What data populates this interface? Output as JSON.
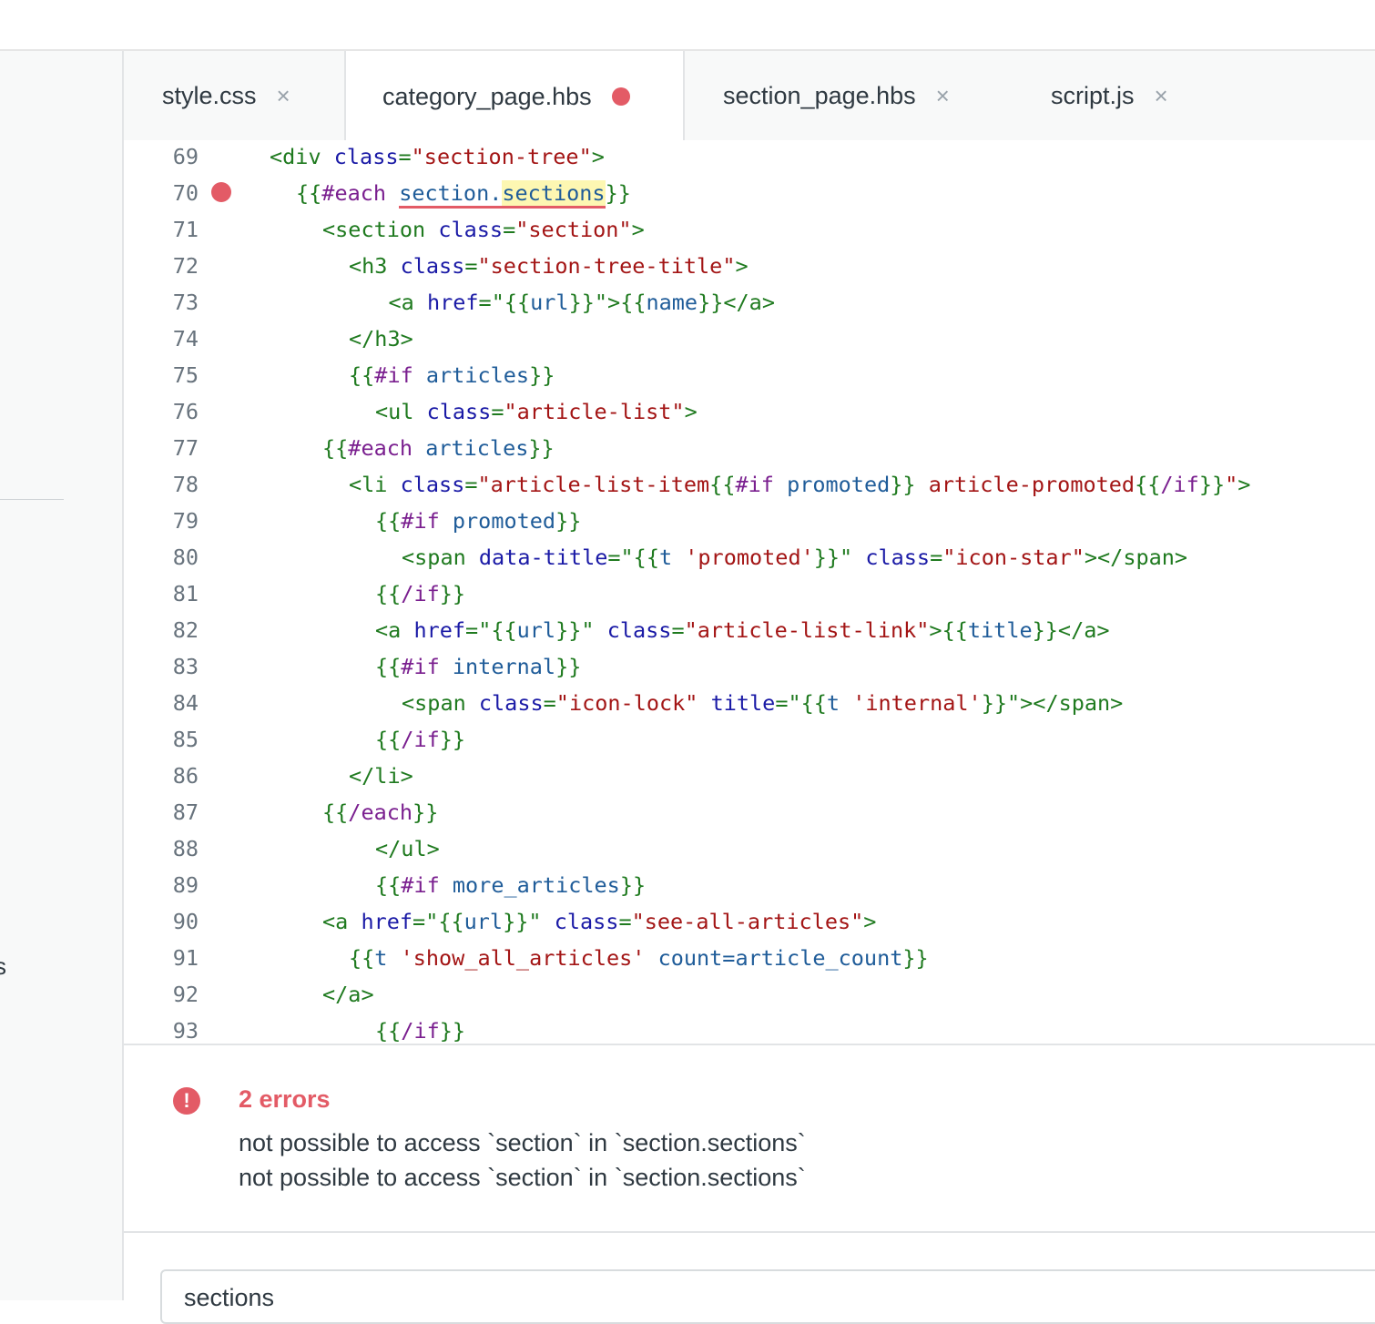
{
  "tabs": [
    {
      "label": "style.css",
      "state": "close",
      "active": false
    },
    {
      "label": "category_page.hbs",
      "state": "error-dot",
      "active": true
    },
    {
      "label": "section_page.hbs",
      "state": "close",
      "active": false
    },
    {
      "label": "script.js",
      "state": "close",
      "active": false
    }
  ],
  "close_glyph": "×",
  "sidebar": {
    "partial_text": "s"
  },
  "code_lines": [
    {
      "n": "69",
      "t": [
        [
          "c-tag",
          "<div "
        ],
        [
          "c-attr",
          "class"
        ],
        [
          "c-tag",
          "="
        ],
        [
          "c-str",
          "\"section-tree\""
        ],
        [
          "c-tag",
          ">"
        ]
      ],
      "indent": 0
    },
    {
      "n": "70",
      "t": [
        [
          "c-hbs",
          "{{"
        ],
        [
          "c-kw",
          "#each "
        ],
        [
          "c-var squiggle",
          "section."
        ],
        [
          "c-var squiggle hl",
          "sections"
        ],
        [
          "c-hbs",
          "}}"
        ]
      ],
      "indent": 1,
      "breakpoint": true
    },
    {
      "n": "71",
      "t": [
        [
          "c-tag",
          "<section "
        ],
        [
          "c-attr",
          "class"
        ],
        [
          "c-tag",
          "="
        ],
        [
          "c-str",
          "\"section\""
        ],
        [
          "c-tag",
          ">"
        ]
      ],
      "indent": 2
    },
    {
      "n": "72",
      "t": [
        [
          "c-tag",
          "<h3 "
        ],
        [
          "c-attr",
          "class"
        ],
        [
          "c-tag",
          "="
        ],
        [
          "c-str",
          "\"section-tree-title\""
        ],
        [
          "c-tag",
          ">"
        ]
      ],
      "indent": 3
    },
    {
      "n": "73",
      "t": [
        [
          "c-tag",
          "<a "
        ],
        [
          "c-attr",
          "href"
        ],
        [
          "c-tag",
          "=\""
        ],
        [
          "c-hbs",
          "{{"
        ],
        [
          "c-var",
          "url"
        ],
        [
          "c-hbs",
          "}}"
        ],
        [
          "c-tag",
          "\">"
        ],
        [
          "c-hbs",
          "{{"
        ],
        [
          "c-var",
          "name"
        ],
        [
          "c-hbs",
          "}}"
        ],
        [
          "c-tag",
          "</a>"
        ]
      ],
      "indent": 4.5
    },
    {
      "n": "74",
      "t": [
        [
          "c-tag",
          "</h3>"
        ]
      ],
      "indent": 3
    },
    {
      "n": "75",
      "t": [
        [
          "c-hbs",
          "{{"
        ],
        [
          "c-kw",
          "#if "
        ],
        [
          "c-var",
          "articles"
        ],
        [
          "c-hbs",
          "}}"
        ]
      ],
      "indent": 3
    },
    {
      "n": "76",
      "t": [
        [
          "c-tag",
          "<ul "
        ],
        [
          "c-attr",
          "class"
        ],
        [
          "c-tag",
          "="
        ],
        [
          "c-str",
          "\"article-list\""
        ],
        [
          "c-tag",
          ">"
        ]
      ],
      "indent": 4
    },
    {
      "n": "77",
      "t": [
        [
          "c-hbs",
          "{{"
        ],
        [
          "c-kw",
          "#each "
        ],
        [
          "c-var",
          "articles"
        ],
        [
          "c-hbs",
          "}}"
        ]
      ],
      "indent": 2
    },
    {
      "n": "78",
      "t": [
        [
          "c-tag",
          "<li "
        ],
        [
          "c-attr",
          "class"
        ],
        [
          "c-tag",
          "="
        ],
        [
          "c-str",
          "\"article-list-item"
        ],
        [
          "c-hbs",
          "{{"
        ],
        [
          "c-kw",
          "#if "
        ],
        [
          "c-var",
          "promoted"
        ],
        [
          "c-hbs",
          "}}"
        ],
        [
          "c-str",
          " article-promoted"
        ],
        [
          "c-hbs",
          "{{"
        ],
        [
          "c-kw",
          "/if"
        ],
        [
          "c-hbs",
          "}}"
        ],
        [
          "c-str",
          "\""
        ],
        [
          "c-tag",
          ">"
        ]
      ],
      "indent": 3
    },
    {
      "n": "79",
      "t": [
        [
          "c-hbs",
          "{{"
        ],
        [
          "c-kw",
          "#if "
        ],
        [
          "c-var",
          "promoted"
        ],
        [
          "c-hbs",
          "}}"
        ]
      ],
      "indent": 4
    },
    {
      "n": "80",
      "t": [
        [
          "c-tag",
          "<span "
        ],
        [
          "c-attr",
          "data-title"
        ],
        [
          "c-tag",
          "=\""
        ],
        [
          "c-hbs",
          "{{"
        ],
        [
          "c-var",
          "t "
        ],
        [
          "c-str",
          "'promoted'"
        ],
        [
          "c-hbs",
          "}}"
        ],
        [
          "c-tag",
          "\" "
        ],
        [
          "c-attr",
          "class"
        ],
        [
          "c-tag",
          "="
        ],
        [
          "c-str",
          "\"icon-star\""
        ],
        [
          "c-tag",
          "></span>"
        ]
      ],
      "indent": 5
    },
    {
      "n": "81",
      "t": [
        [
          "c-hbs",
          "{{"
        ],
        [
          "c-kw",
          "/if"
        ],
        [
          "c-hbs",
          "}}"
        ]
      ],
      "indent": 4
    },
    {
      "n": "82",
      "t": [
        [
          "c-tag",
          "<a "
        ],
        [
          "c-attr",
          "href"
        ],
        [
          "c-tag",
          "=\""
        ],
        [
          "c-hbs",
          "{{"
        ],
        [
          "c-var",
          "url"
        ],
        [
          "c-hbs",
          "}}"
        ],
        [
          "c-tag",
          "\" "
        ],
        [
          "c-attr",
          "class"
        ],
        [
          "c-tag",
          "="
        ],
        [
          "c-str",
          "\"article-list-link\""
        ],
        [
          "c-tag",
          ">"
        ],
        [
          "c-hbs",
          "{{"
        ],
        [
          "c-var",
          "title"
        ],
        [
          "c-hbs",
          "}}"
        ],
        [
          "c-tag",
          "</a>"
        ]
      ],
      "indent": 4
    },
    {
      "n": "83",
      "t": [
        [
          "c-hbs",
          "{{"
        ],
        [
          "c-kw",
          "#if "
        ],
        [
          "c-var",
          "internal"
        ],
        [
          "c-hbs",
          "}}"
        ]
      ],
      "indent": 4
    },
    {
      "n": "84",
      "t": [
        [
          "c-tag",
          "<span "
        ],
        [
          "c-attr",
          "class"
        ],
        [
          "c-tag",
          "="
        ],
        [
          "c-str",
          "\"icon-lock\" "
        ],
        [
          "c-attr",
          "title"
        ],
        [
          "c-tag",
          "=\""
        ],
        [
          "c-hbs",
          "{{"
        ],
        [
          "c-var",
          "t "
        ],
        [
          "c-str",
          "'internal'"
        ],
        [
          "c-hbs",
          "}}"
        ],
        [
          "c-tag",
          "\"></span>"
        ]
      ],
      "indent": 5
    },
    {
      "n": "85",
      "t": [
        [
          "c-hbs",
          "{{"
        ],
        [
          "c-kw",
          "/if"
        ],
        [
          "c-hbs",
          "}}"
        ]
      ],
      "indent": 4
    },
    {
      "n": "86",
      "t": [
        [
          "c-tag",
          "</li>"
        ]
      ],
      "indent": 3
    },
    {
      "n": "87",
      "t": [
        [
          "c-hbs",
          "{{"
        ],
        [
          "c-kw",
          "/each"
        ],
        [
          "c-hbs",
          "}}"
        ]
      ],
      "indent": 2
    },
    {
      "n": "88",
      "t": [
        [
          "c-tag",
          "</ul>"
        ]
      ],
      "indent": 4
    },
    {
      "n": "89",
      "t": [
        [
          "c-hbs",
          "{{"
        ],
        [
          "c-kw",
          "#if "
        ],
        [
          "c-var",
          "more_articles"
        ],
        [
          "c-hbs",
          "}}"
        ]
      ],
      "indent": 4
    },
    {
      "n": "90",
      "t": [
        [
          "c-tag",
          "<a "
        ],
        [
          "c-attr",
          "href"
        ],
        [
          "c-tag",
          "=\""
        ],
        [
          "c-hbs",
          "{{"
        ],
        [
          "c-var",
          "url"
        ],
        [
          "c-hbs",
          "}}"
        ],
        [
          "c-tag",
          "\" "
        ],
        [
          "c-attr",
          "class"
        ],
        [
          "c-tag",
          "="
        ],
        [
          "c-str",
          "\"see-all-articles\""
        ],
        [
          "c-tag",
          ">"
        ]
      ],
      "indent": 2
    },
    {
      "n": "91",
      "t": [
        [
          "c-hbs",
          "{{"
        ],
        [
          "c-var",
          "t "
        ],
        [
          "c-str",
          "'show_all_articles' "
        ],
        [
          "c-var",
          "count=article_count"
        ],
        [
          "c-hbs",
          "}}"
        ]
      ],
      "indent": 3
    },
    {
      "n": "92",
      "t": [
        [
          "c-tag",
          "</a>"
        ]
      ],
      "indent": 2
    },
    {
      "n": "93",
      "t": [
        [
          "c-hbs",
          "{{"
        ],
        [
          "c-kw",
          "/if"
        ],
        [
          "c-hbs",
          "}}"
        ]
      ],
      "indent": 4
    }
  ],
  "errors_panel": {
    "icon": "!",
    "title": "2 errors",
    "messages": [
      "not possible to access `section` in `section.sections`",
      "not possible to access `section` in `section.sections`"
    ]
  },
  "search": {
    "value": "sections"
  },
  "colors": {
    "error": "#e35b66",
    "tag": "#1f7a1f",
    "attr": "#1a1aa6",
    "string": "#a31515"
  }
}
